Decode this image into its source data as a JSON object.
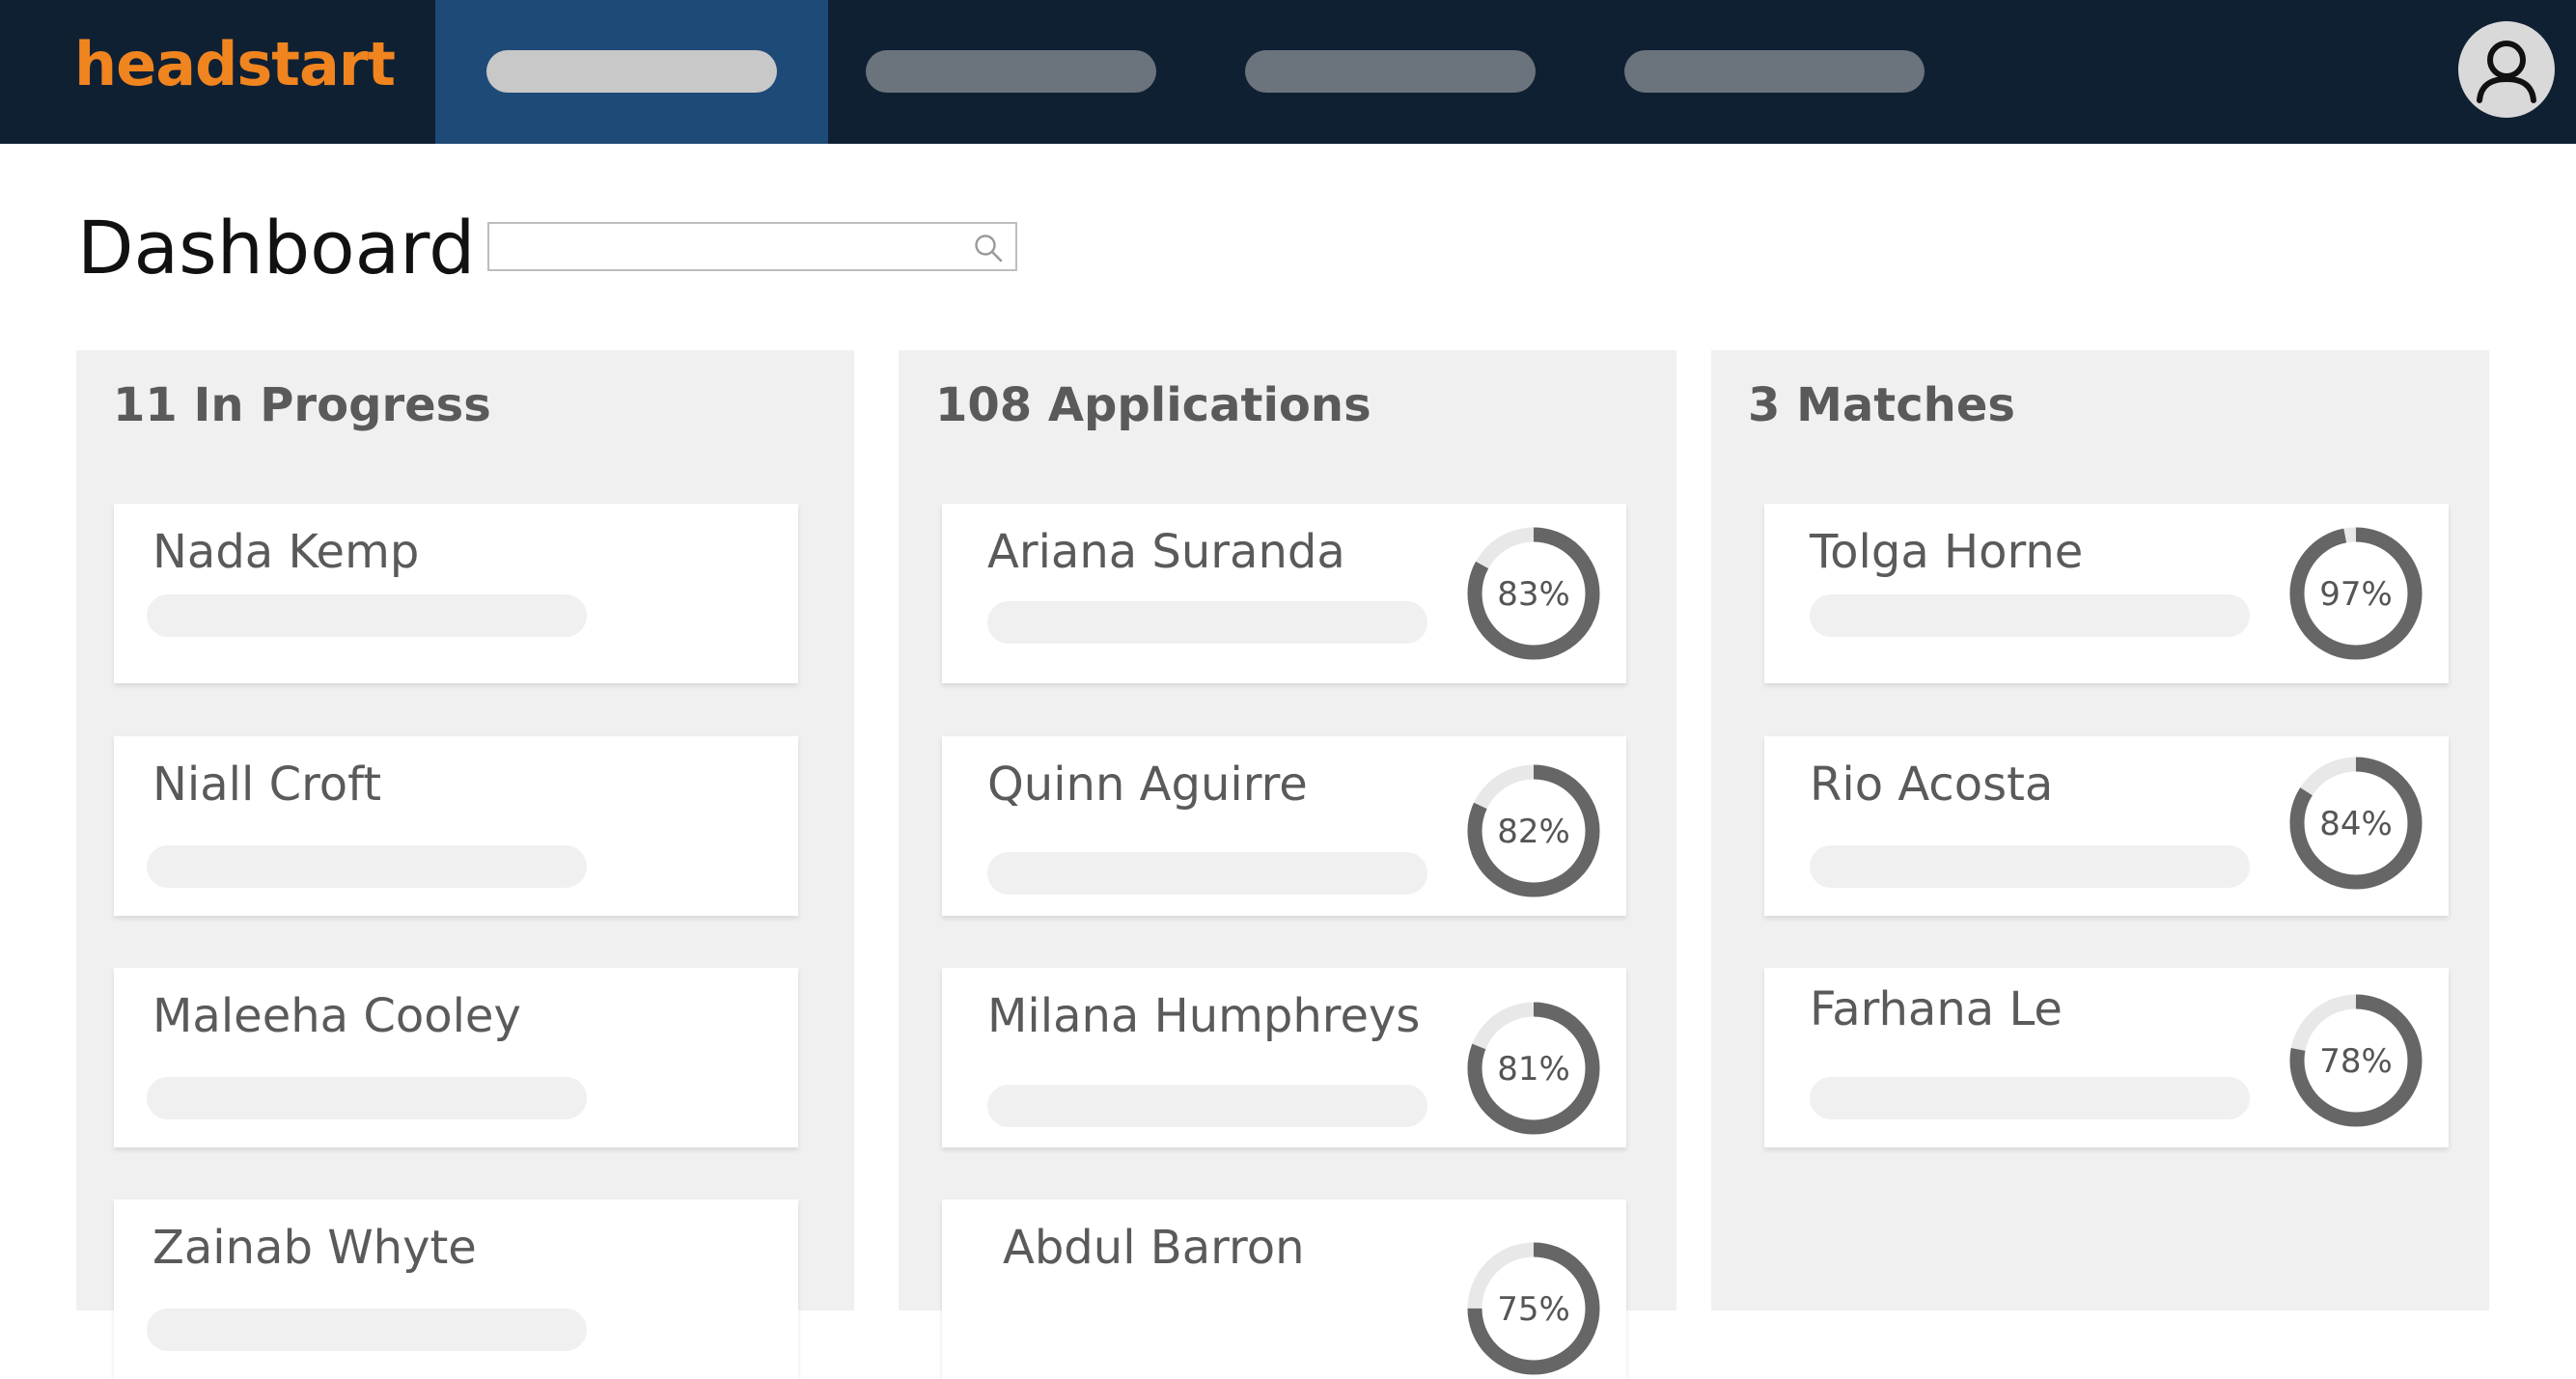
{
  "brand": {
    "logo_text": "headstart",
    "accent": "#f0841e"
  },
  "nav": {
    "tabs": [
      "",
      "",
      "",
      ""
    ],
    "active_index": 0
  },
  "header": {
    "title": "Dashboard"
  },
  "search": {
    "value": "",
    "placeholder": ""
  },
  "colors": {
    "topbar": "#102033",
    "active_tab": "#1e4a77",
    "ring": "#666666",
    "ring_track": "#e8e8e8"
  },
  "columns": [
    {
      "title": "11 In Progress",
      "cards": [
        {
          "name": "Nada Kemp"
        },
        {
          "name": "Niall Croft"
        },
        {
          "name": "Maleeha Cooley"
        },
        {
          "name": "Zainab Whyte"
        }
      ]
    },
    {
      "title": "108 Applications",
      "cards": [
        {
          "name": "Ariana Suranda",
          "score": "83%",
          "score_value": 83
        },
        {
          "name": "Quinn Aguirre",
          "score": "82%",
          "score_value": 82
        },
        {
          "name": "Milana Humphreys",
          "score": "81%",
          "score_value": 81
        },
        {
          "name": "Abdul Barron",
          "score": "75%",
          "score_value": 75
        }
      ]
    },
    {
      "title": "3 Matches",
      "cards": [
        {
          "name": "Tolga Horne",
          "score": "97%",
          "score_value": 97
        },
        {
          "name": "Rio Acosta",
          "score": "84%",
          "score_value": 84
        },
        {
          "name": "Farhana Le",
          "score": "78%",
          "score_value": 78
        }
      ]
    }
  ]
}
